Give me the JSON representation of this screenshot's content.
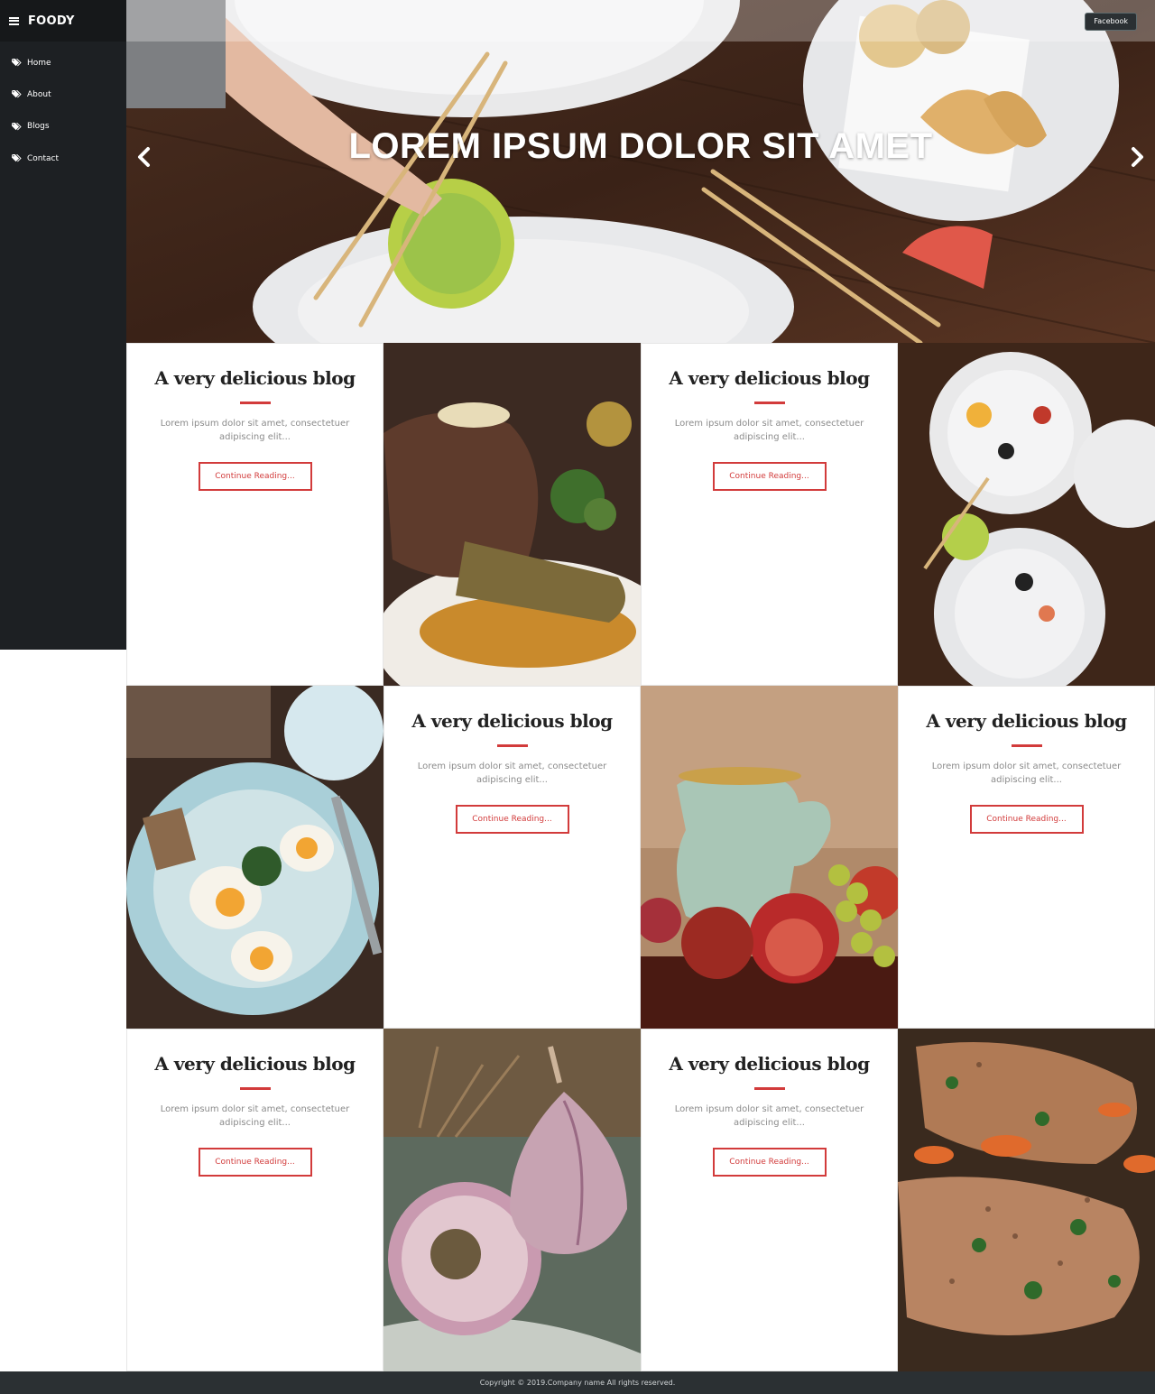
{
  "sidebar": {
    "brand": "FOODY",
    "items": [
      {
        "label": "Home"
      },
      {
        "label": "About"
      },
      {
        "label": "Blogs"
      },
      {
        "label": "Contact"
      }
    ]
  },
  "hero": {
    "title": "LOREM IPSUM DOLOR SIT AMET",
    "facebook_label": "Facebook"
  },
  "cards": [
    {
      "title": "A very delicious blog",
      "text": "Lorem ipsum dolor sit amet, consectetuer adipiscing elit...",
      "button": "Continue Reading..."
    },
    {
      "title": "A very delicious blog",
      "text": "Lorem ipsum dolor sit amet, consectetuer adipiscing elit...",
      "button": "Continue Reading..."
    },
    {
      "title": "A very delicious blog",
      "text": "Lorem ipsum dolor sit amet, consectetuer adipiscing elit...",
      "button": "Continue Reading..."
    },
    {
      "title": "A very delicious blog",
      "text": "Lorem ipsum dolor sit amet, consectetuer adipiscing elit...",
      "button": "Continue Reading..."
    },
    {
      "title": "A very delicious blog",
      "text": "Lorem ipsum dolor sit amet, consectetuer adipiscing elit...",
      "button": "Continue Reading..."
    },
    {
      "title": "A very delicious blog",
      "text": "Lorem ipsum dolor sit amet, consectetuer adipiscing elit...",
      "button": "Continue Reading..."
    }
  ],
  "footer": {
    "copyright": "Copyright © 2019.Company name All rights reserved."
  },
  "colors": {
    "accent": "#d23b3b",
    "sidebar_bg": "#1d2023",
    "footer_bg": "#2b3033"
  }
}
